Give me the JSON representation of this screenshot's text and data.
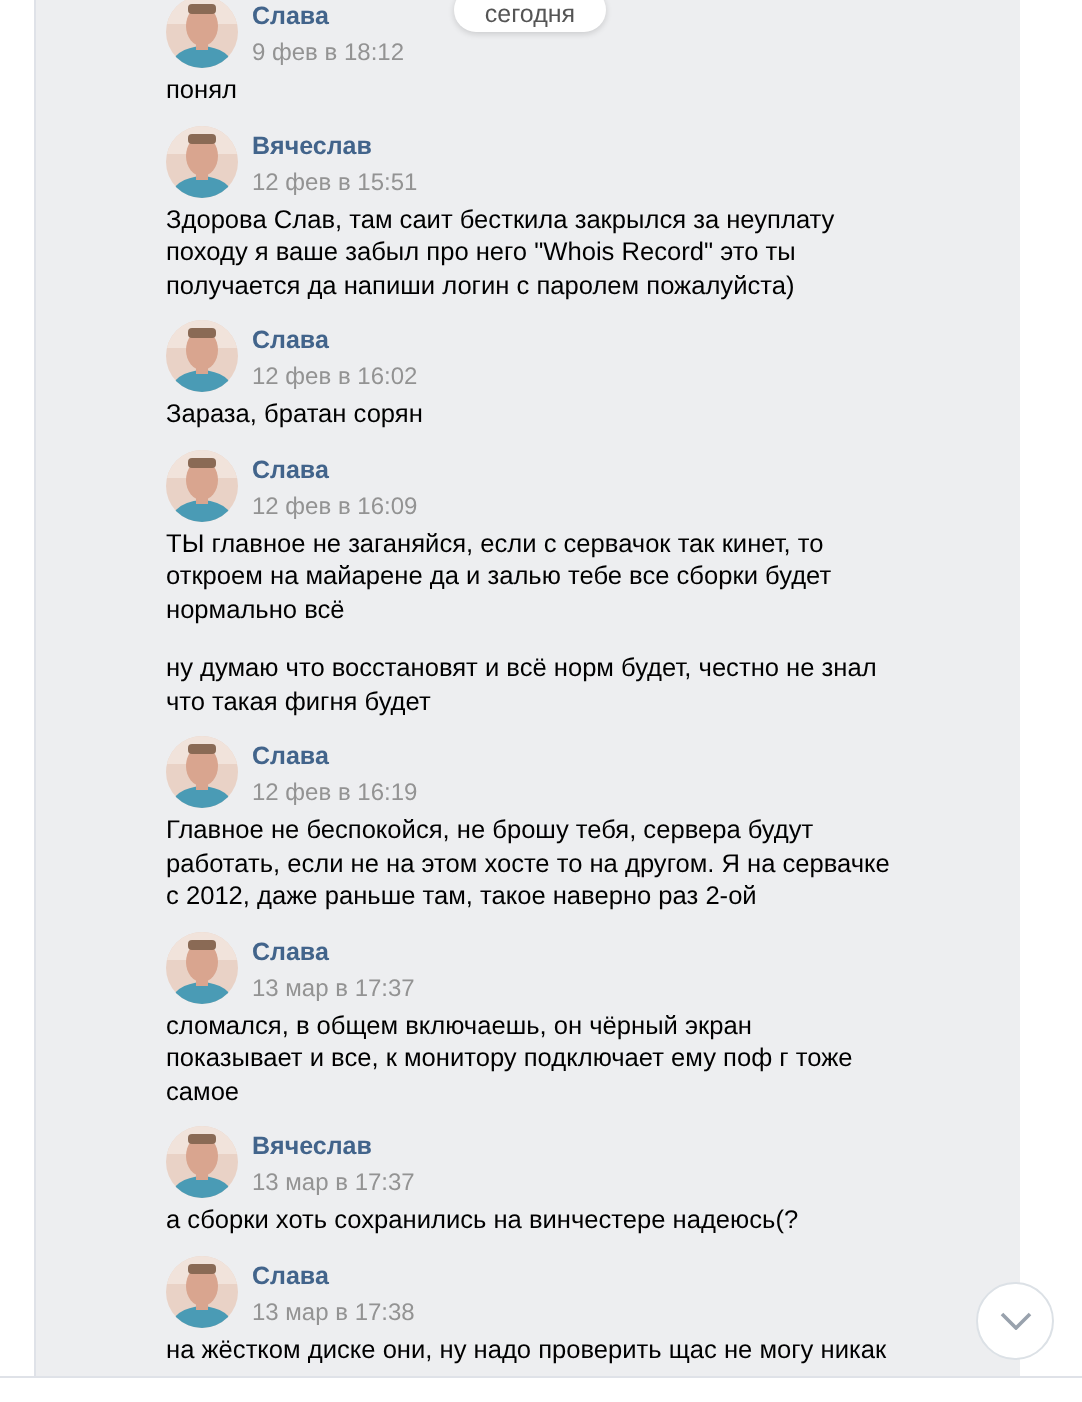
{
  "date_pill": "сегодня",
  "messages": [
    {
      "author": "Слава",
      "time": "9 фев в 18:12",
      "avatar": {
        "kind": "picture"
      },
      "paragraphs": [
        "понял"
      ]
    },
    {
      "author": "Вячеслав",
      "time": "12 фев в 15:51",
      "avatar": {
        "kind": "picture"
      },
      "paragraphs": [
        "Здорова Слав, там саит бесткила закрылся за неуплату\nпоходу я ваше забыл про него \"Whois Record\" это ты\nполучается да напиши логин с паролем пожалуйста)"
      ]
    },
    {
      "author": "Слава",
      "time": "12 фев в 16:02",
      "avatar": {
        "kind": "picture"
      },
      "paragraphs": [
        "Зараза, братан сорян"
      ]
    },
    {
      "author": "Слава",
      "time": "12 фев в 16:09",
      "avatar": {
        "kind": "picture"
      },
      "paragraphs": [
        "ТЫ главное не заганяйся, если с сервачок так кинет, то\nоткроем на майарене да и залью тебе все сборки будет\nнормально всё",
        "ну думаю что восстановят и всё норм будет, честно не знал\nчто такая фигня будет"
      ]
    },
    {
      "author": "Слава",
      "time": "12 фев в 16:19",
      "avatar": {
        "kind": "picture"
      },
      "paragraphs": [
        "Главное не беспокойся, не брошу тебя, сервера будут\nработать, если не на этом хосте то на другом. Я на сервачке\nс 2012, даже раньше там, такое наверно раз 2-ой"
      ]
    },
    {
      "author": "Слава",
      "time": "13 мар в 17:37",
      "avatar": {
        "kind": "picture"
      },
      "paragraphs": [
        "сломался, в общем включаешь, он чёрный экран\nпоказывает и все, к монитору подключает ему поф г тоже\nсамое"
      ]
    },
    {
      "author": "Вячеслав",
      "time": "13 мар в 17:37",
      "avatar": {
        "kind": "picture"
      },
      "paragraphs": [
        "а сборки хоть сохранились на винчестере надеюсь(?"
      ]
    },
    {
      "author": "Слава",
      "time": "13 мар в 17:38",
      "avatar": {
        "kind": "picture"
      },
      "paragraphs": [
        "на жёстком диске они, ну надо проверить щас не могу никак"
      ]
    }
  ]
}
